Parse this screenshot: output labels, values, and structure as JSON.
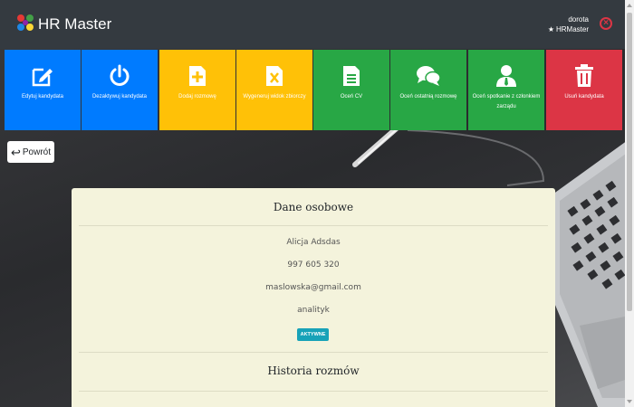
{
  "header": {
    "app_title": "HR Master",
    "user_name": "dorota",
    "company": "HRMaster"
  },
  "actions": [
    {
      "label": "Edytuj kandydata",
      "color": "#007bff",
      "icon": "edit-icon"
    },
    {
      "label": "Dezaktywuj kandydata",
      "color": "#007bff",
      "icon": "power-icon"
    },
    {
      "label": "Dodaj rozmowę",
      "color": "#ffc107",
      "icon": "file-plus-icon"
    },
    {
      "label": "Wygeneruj widok zbiorczy",
      "color": "#ffc107",
      "icon": "file-excel-icon"
    },
    {
      "label": "Oceń CV",
      "color": "#28a745",
      "icon": "file-text-icon"
    },
    {
      "label": "Oceń ostatnią rozmowę",
      "color": "#28a745",
      "icon": "comments-icon"
    },
    {
      "label": "Oceń spotkanie z członkiem zarządu",
      "color": "#28a745",
      "icon": "user-tie-icon"
    },
    {
      "label": "Usuń kandydata",
      "color": "#dc3545",
      "icon": "trash-icon"
    }
  ],
  "back_button": {
    "label": "Powrót"
  },
  "personal": {
    "title": "Dane osobowe",
    "name": "Alicja Adsdas",
    "phone": "997 605 320",
    "email": "maslowska@gmail.com",
    "position": "analityk",
    "status": "AKTYWNE"
  },
  "history": {
    "title": "Historia rozmów"
  }
}
